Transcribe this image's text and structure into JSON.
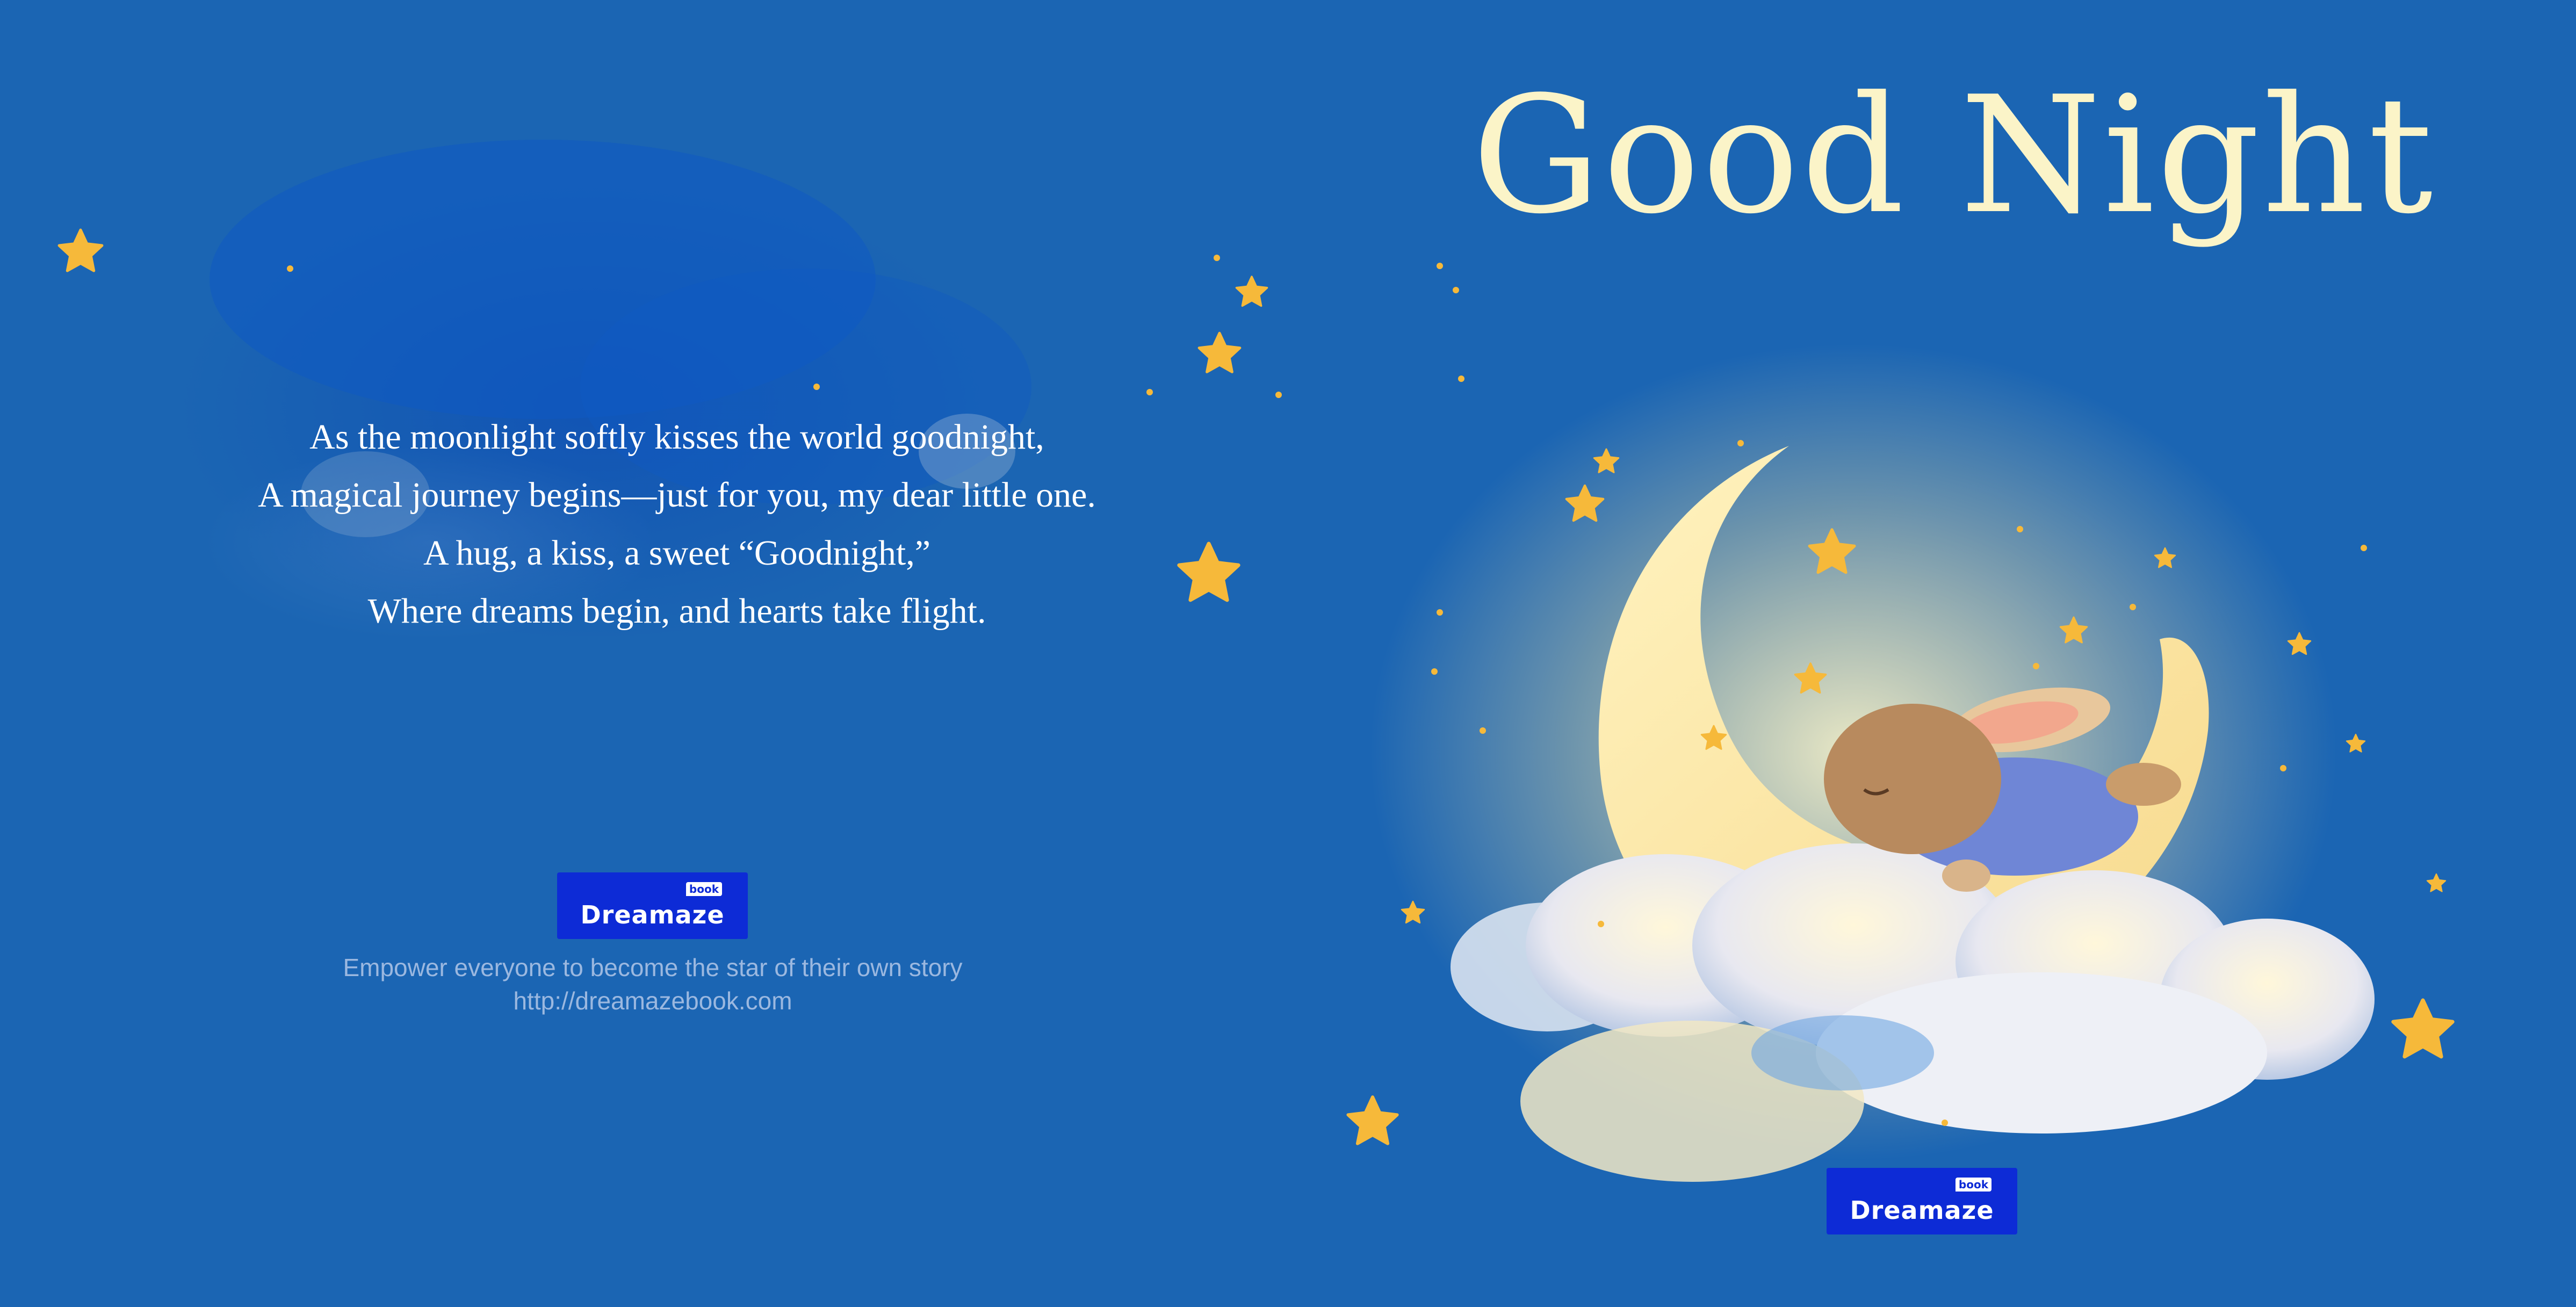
{
  "cover": {
    "title": "Good Night",
    "poem": [
      "As the moonlight softly kisses the world goodnight,",
      "A magical journey begins—just for you, my dear little one.",
      "A hug, a kiss, a sweet “Goodnight,”",
      "Where dreams begin, and hearts take flight."
    ],
    "publisher": {
      "logo_word": "Dreamaze",
      "logo_badge": "book",
      "tagline": "Empower everyone to become the star of  their own story",
      "url": "http://dreamazebook.com"
    }
  },
  "colors": {
    "background": "#1b65b3",
    "title": "#fbf4c8",
    "star": "#f6b93a",
    "logo_bg": "#0d2bd6",
    "moon": "#fbe9a6"
  },
  "illustration": {
    "icons": [
      "star-icon",
      "crescent-moon-icon",
      "cloud-icon",
      "sleeping-bunny-icon"
    ]
  }
}
